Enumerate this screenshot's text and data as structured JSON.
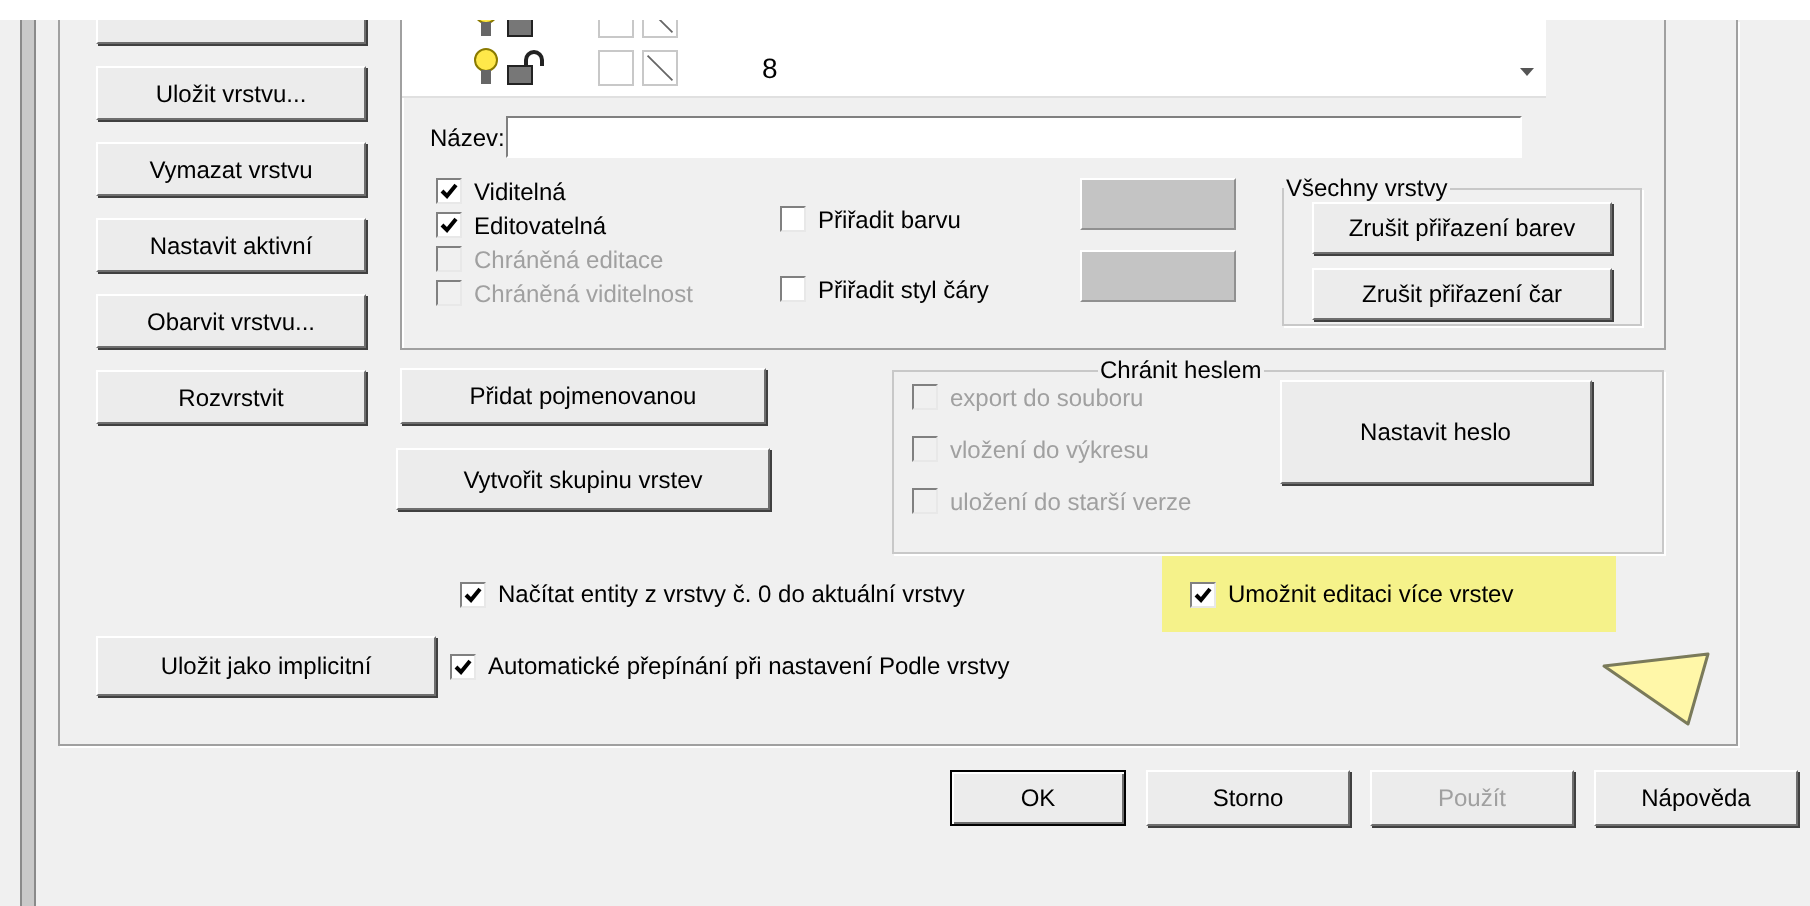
{
  "left_buttons": [
    {
      "label": "Uložit vrstvu..."
    },
    {
      "label": "Vymazat vrstvu"
    },
    {
      "label": "Nastavit aktivní"
    },
    {
      "label": "Obarvit vrstvu..."
    },
    {
      "label": "Rozvrstvit"
    }
  ],
  "layer_list": {
    "rows": [
      {
        "on": true,
        "locked": false
      },
      {
        "on": true,
        "locked": false,
        "number": "8"
      }
    ]
  },
  "name_field": {
    "label": "Název:"
  },
  "layer_options": [
    {
      "label": "Viditelná",
      "checked": true,
      "disabled": false
    },
    {
      "label": "Editovatelná",
      "checked": true,
      "disabled": false
    },
    {
      "label": "Chráněná editace",
      "checked": false,
      "disabled": true
    },
    {
      "label": "Chráněná viditelnost",
      "checked": false,
      "disabled": true
    }
  ],
  "assign": [
    {
      "label": "Přiřadit barvu",
      "checked": false
    },
    {
      "label": "Přiřadit styl čáry",
      "checked": false
    }
  ],
  "all_layers": {
    "title": "Všechny vrstvy",
    "buttons": [
      "Zrušit přiřazení barev",
      "Zrušit přiřazení čar"
    ]
  },
  "group_buttons": [
    "Přidat pojmenovanou",
    "Vytvořit skupinu vrstev"
  ],
  "password": {
    "title": "Chránit heslem",
    "options": [
      {
        "label": "export do souboru",
        "checked": false,
        "disabled": true
      },
      {
        "label": "vložení do výkresu",
        "checked": false,
        "disabled": true
      },
      {
        "label": "uložení do starší verze",
        "checked": false,
        "disabled": true
      }
    ],
    "button": "Nastavit heslo"
  },
  "load_layer0": {
    "label": "Načítat entity z vrstvy č. 0 do aktuální vrstvy",
    "checked": true
  },
  "multi_edit": {
    "label": "Umožnit editaci více vrstev",
    "checked": true,
    "highlighted": true
  },
  "save_default": {
    "label": "Uložit jako implicitní"
  },
  "auto_switch": {
    "label": "Automatické přepínání při nastavení Podle vrstvy",
    "checked": true
  },
  "dialog_buttons": [
    {
      "label": "OK",
      "default": true,
      "disabled": false
    },
    {
      "label": "Storno",
      "default": false,
      "disabled": false
    },
    {
      "label": "Použít",
      "default": false,
      "disabled": true
    },
    {
      "label": "Nápověda",
      "default": false,
      "disabled": false
    }
  ]
}
